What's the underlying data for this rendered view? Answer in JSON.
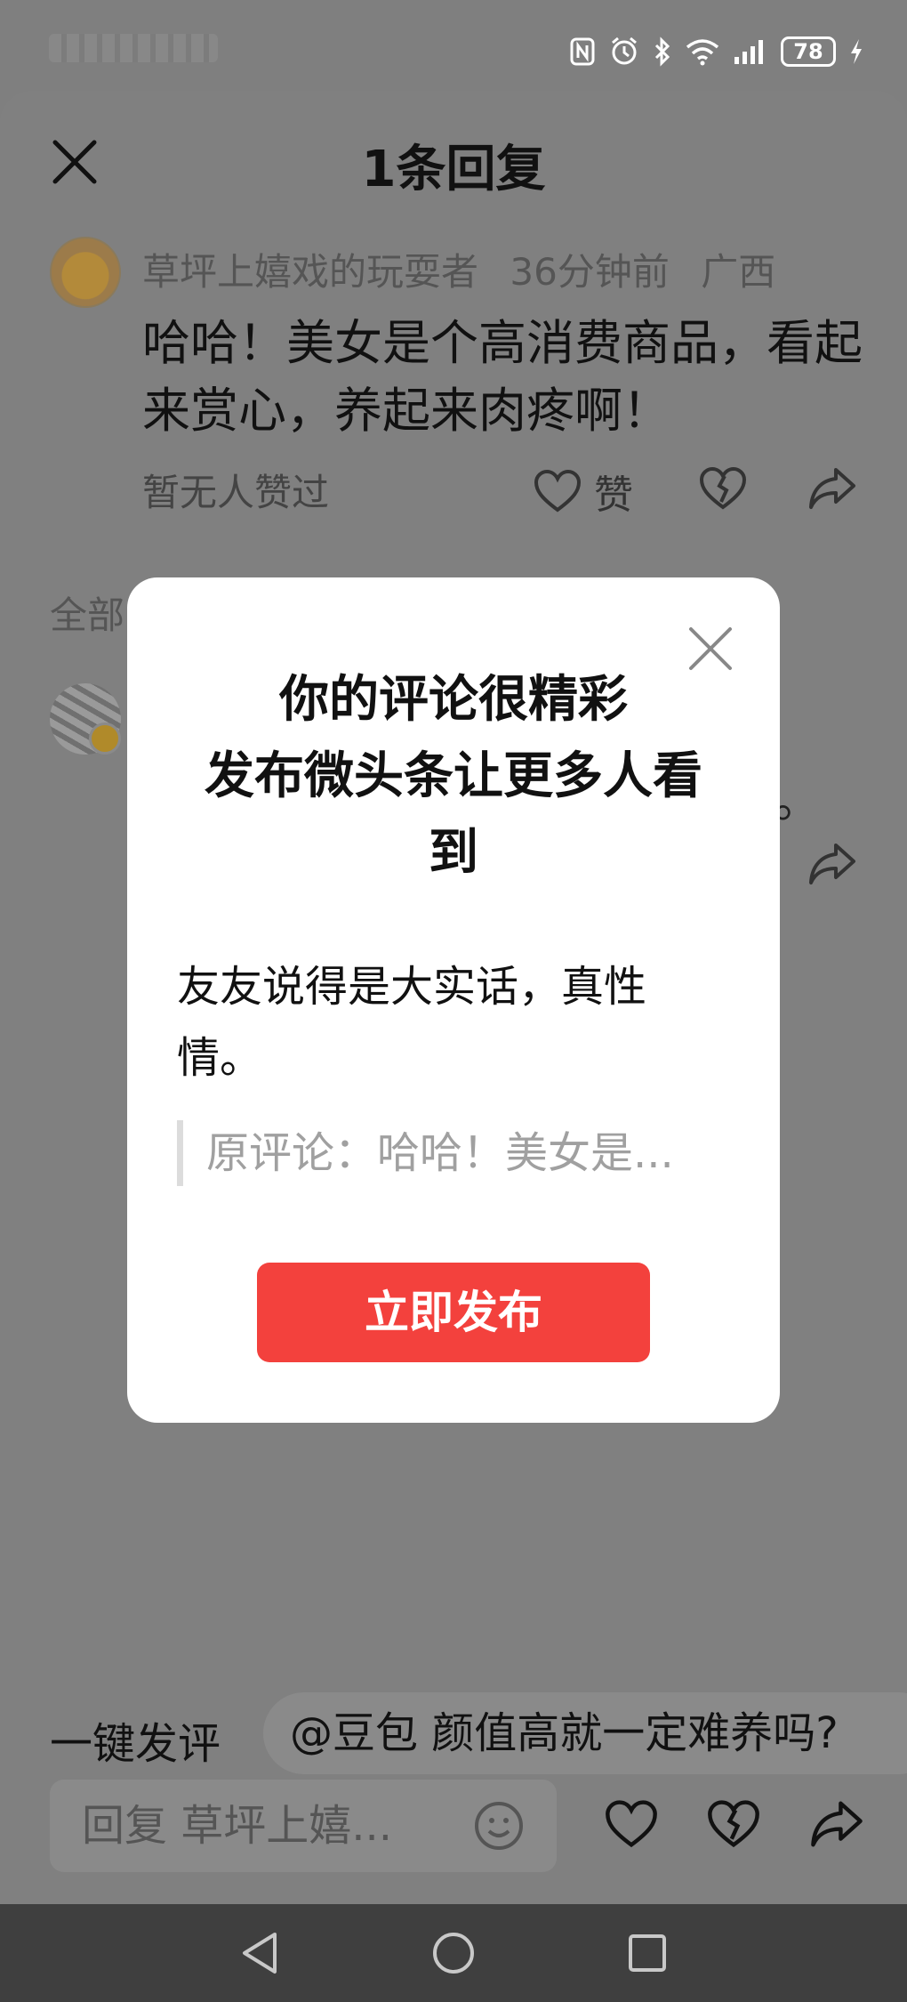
{
  "status_bar": {
    "battery": "78"
  },
  "header": {
    "title": "1条回复"
  },
  "comment": {
    "author": "草坪上嬉戏的玩耍者",
    "time": "36分钟前",
    "location": "广西",
    "text": "哈哈！美女是个高消费商品，看起来赏心，养起来肉疼啊！",
    "likes_text": "暂无人赞过",
    "like_label": "赞"
  },
  "section": {
    "label": "全部"
  },
  "reply_preview": {
    "tail": "。"
  },
  "modal": {
    "title_line1": "你的评论很精彩",
    "title_line2": "发布微头条让更多人看到",
    "body": "友友说得是大实话，真性情。",
    "quote": "原评论：哈哈！美女是...",
    "publish_button": "立即发布"
  },
  "bottom": {
    "quick_comment_label": "一键发评",
    "quick_chip": "@豆包 颜值高就一定难养吗?",
    "reply_placeholder": "回复 草坪上嬉..."
  },
  "colors": {
    "accent": "#f3413d",
    "overlay": "#7f7f7f"
  }
}
